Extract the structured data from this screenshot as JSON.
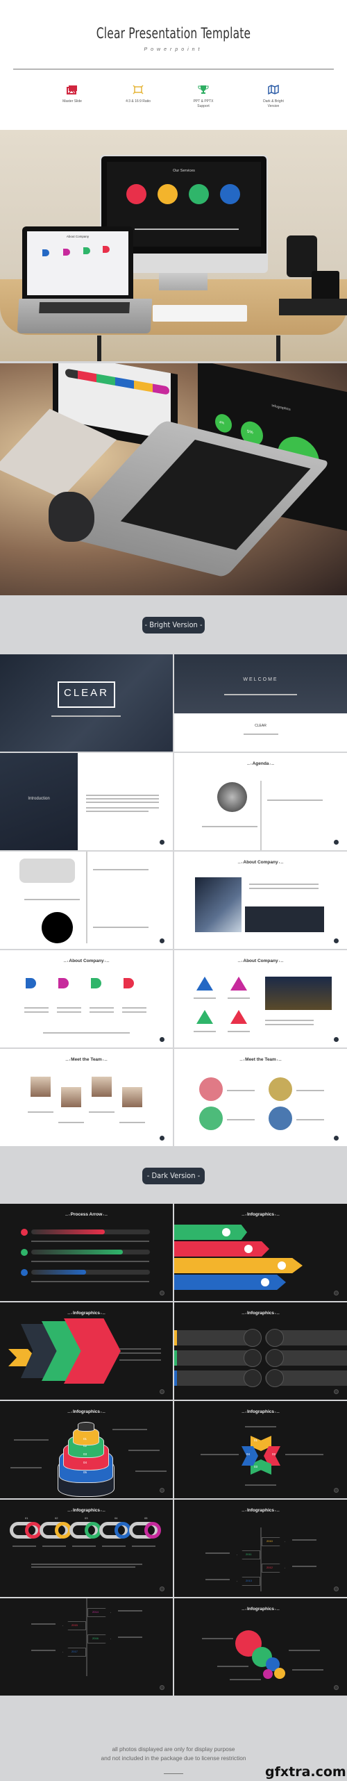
{
  "header": {
    "title": "Clear Presentation Template",
    "subtitle": "Powerpoint",
    "features": [
      {
        "icon": "images-icon",
        "label": "Master Slide",
        "color": "#d0263f"
      },
      {
        "icon": "resize-icon",
        "label": "4:3 & 16:9 Ratio",
        "color": "#e6b63a"
      },
      {
        "icon": "trophy-icon",
        "label": "PPT & PPTX Support",
        "color": "#2eae62"
      },
      {
        "icon": "map-icon",
        "label": "Dark & Bright Version",
        "color": "#2e5ea8"
      }
    ]
  },
  "photo1": {
    "screen_title": "Our Services",
    "laptop_title": "About Company",
    "service_colors": [
      "#e8304a",
      "#f3b42c",
      "#2fb56a",
      "#2468c4"
    ]
  },
  "photo2": {
    "screen_title": "Infographics",
    "tree_values": [
      "4%",
      "5%",
      "7%"
    ]
  },
  "bright_label": "- Bright Version -",
  "dark_label": "- Dark Version -",
  "bright_slides": [
    {
      "kind": "cover",
      "title": "CLEAR"
    },
    {
      "kind": "welcome",
      "title": "WELCOME",
      "sub": "CLEAR"
    },
    {
      "kind": "intro",
      "title": "Introduction"
    },
    {
      "kind": "agenda",
      "title": "Agenda"
    },
    {
      "kind": "timeline",
      "title": ""
    },
    {
      "kind": "about-photo",
      "title": "About Company"
    },
    {
      "kind": "about-tabs",
      "title": "About Company"
    },
    {
      "kind": "about-tri",
      "title": "About Company"
    },
    {
      "kind": "team-4",
      "title": "Meet the Team"
    },
    {
      "kind": "team-circles",
      "title": "Meet the Team"
    }
  ],
  "dark_slides": [
    {
      "kind": "process",
      "title": "Process Arrow"
    },
    {
      "kind": "ribbons",
      "title": "Infographics"
    },
    {
      "kind": "chevrons",
      "title": "Infographics"
    },
    {
      "kind": "options",
      "title": "Infographics"
    },
    {
      "kind": "pyramid",
      "title": "Infographics",
      "labels": [
        "01",
        "02",
        "03",
        "04",
        "05"
      ]
    },
    {
      "kind": "cross",
      "title": "Infographics",
      "labels": [
        "01",
        "02",
        "03",
        "04"
      ]
    },
    {
      "kind": "chain",
      "title": "Infographics",
      "labels": [
        "01",
        "02",
        "03",
        "04",
        "05"
      ]
    },
    {
      "kind": "signs",
      "title": "Infographics",
      "labels": [
        "2010",
        "2011",
        "2012",
        "2013"
      ]
    },
    {
      "kind": "signs2",
      "title": "",
      "labels": [
        "2014",
        "2015",
        "2016",
        "2017"
      ]
    },
    {
      "kind": "bubbles",
      "title": "Infographics"
    }
  ],
  "colors": {
    "red": "#e8304a",
    "yellow": "#f3b42c",
    "green": "#2fb56a",
    "blue": "#2468c4",
    "magenta": "#c72a9c",
    "navy": "#2a333f"
  },
  "footer": {
    "line1": "all photos displayed are only for display purpose",
    "line2": "and not included in the package due to license restriction",
    "watermark": "gfxtra.com"
  }
}
